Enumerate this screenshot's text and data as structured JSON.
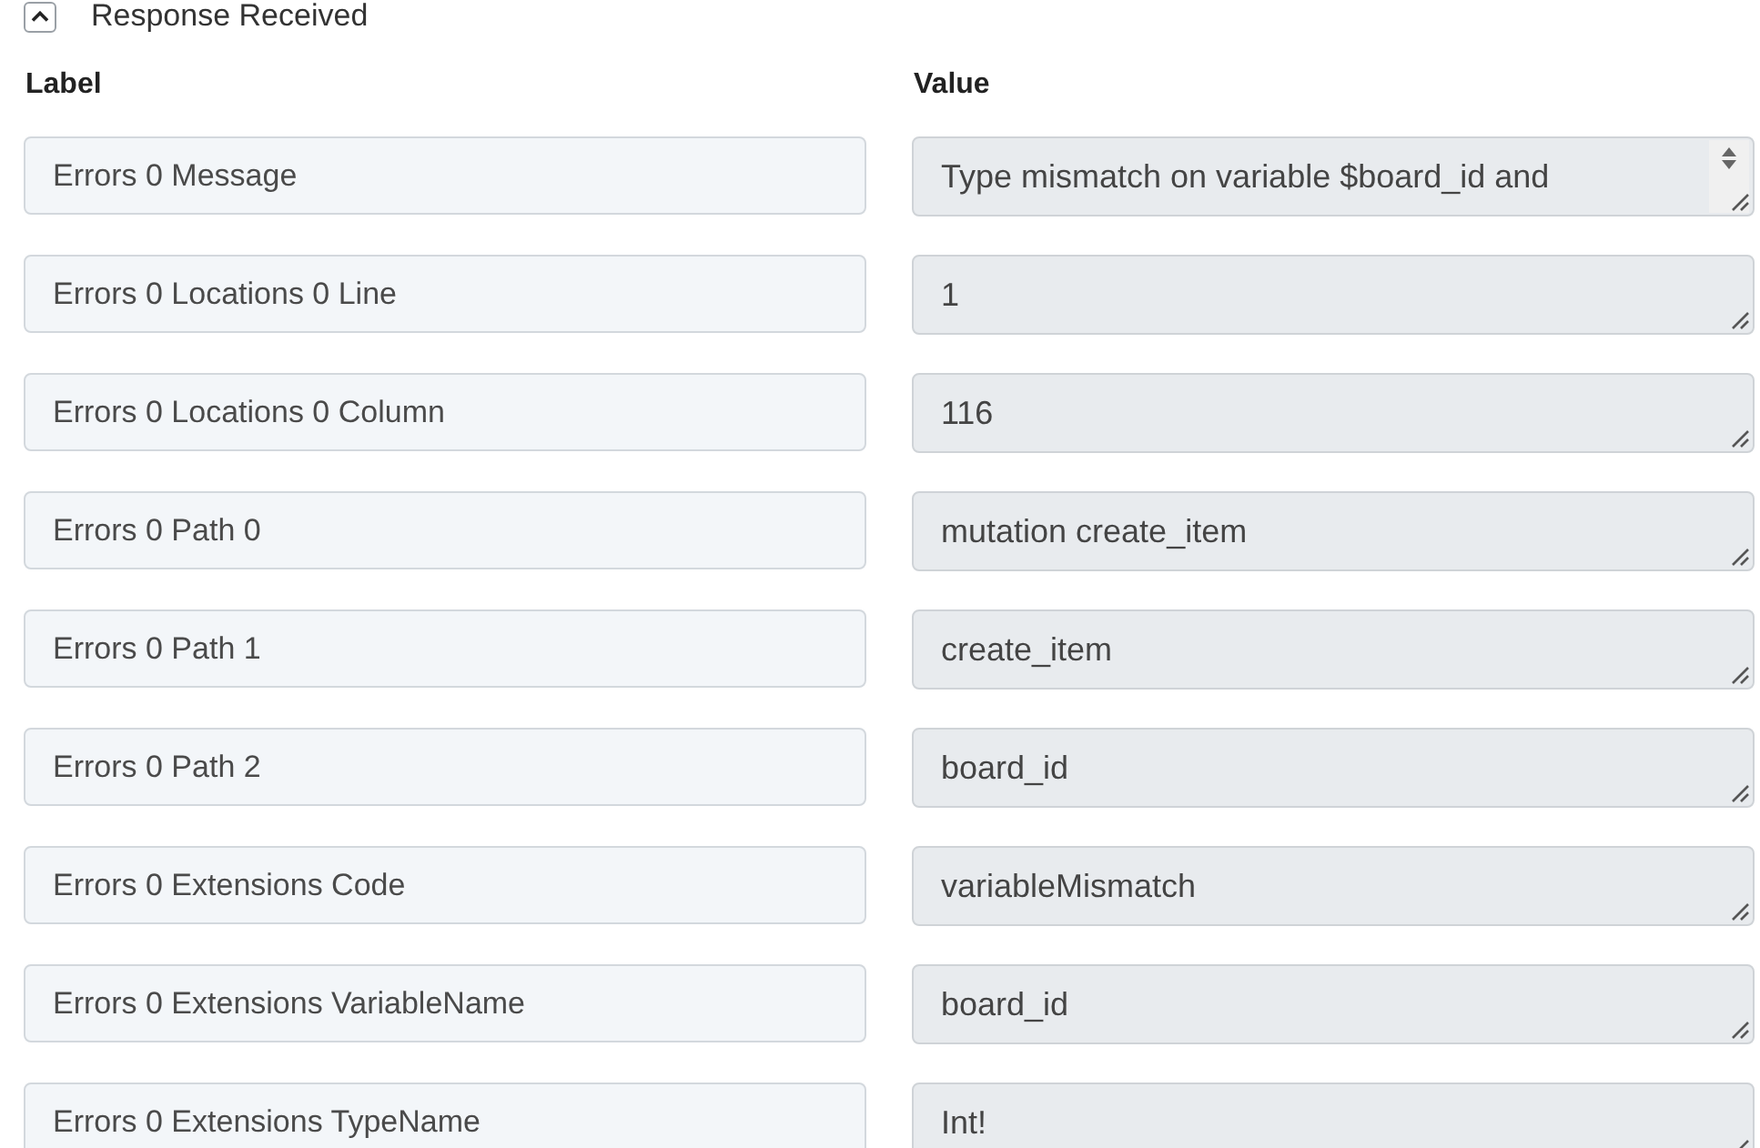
{
  "section": {
    "title": "Response Received",
    "expanded": true
  },
  "columns": [
    "Label",
    "Value"
  ],
  "rows": [
    {
      "label": "Errors 0 Message",
      "value": "Type mismatch on variable $board_id and",
      "overflowing": true
    },
    {
      "label": "Errors 0 Locations 0 Line",
      "value": "1",
      "overflowing": false
    },
    {
      "label": "Errors 0 Locations 0 Column",
      "value": "116",
      "overflowing": false
    },
    {
      "label": "Errors 0 Path 0",
      "value": "mutation create_item",
      "overflowing": false
    },
    {
      "label": "Errors 0 Path 1",
      "value": "create_item",
      "overflowing": false
    },
    {
      "label": "Errors 0 Path 2",
      "value": "board_id",
      "overflowing": false
    },
    {
      "label": "Errors 0 Extensions Code",
      "value": "variableMismatch",
      "overflowing": false
    },
    {
      "label": "Errors 0 Extensions VariableName",
      "value": "board_id",
      "overflowing": false
    },
    {
      "label": "Errors 0 Extensions TypeName",
      "value": "Int!",
      "overflowing": false
    }
  ]
}
